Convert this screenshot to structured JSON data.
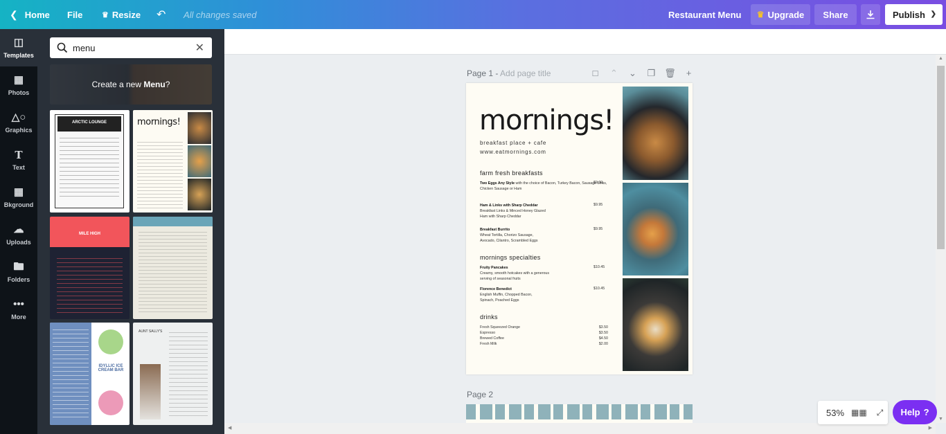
{
  "topbar": {
    "home_label": "Home",
    "file_label": "File",
    "resize_label": "Resize",
    "status": "All changes saved",
    "design_title": "Restaurant Menu",
    "upgrade_label": "Upgrade",
    "share_label": "Share",
    "publish_label": "Publish",
    "icons": {
      "home": "chevron-left-icon",
      "resize": "crown-icon",
      "undo": "undo-icon",
      "download": "download-icon",
      "publish": "chevron-down-icon"
    }
  },
  "rail": {
    "items": [
      {
        "label": "Templates",
        "icon": "templates-icon",
        "active": true
      },
      {
        "label": "Photos",
        "icon": "photos-icon"
      },
      {
        "label": "Graphics",
        "icon": "graphics-icon"
      },
      {
        "label": "Text",
        "icon": "text-icon"
      },
      {
        "label": "Bkground",
        "icon": "background-icon"
      },
      {
        "label": "Uploads",
        "icon": "upload-icon"
      },
      {
        "label": "Folders",
        "icon": "folder-icon"
      },
      {
        "label": "More",
        "icon": "more-icon"
      }
    ]
  },
  "panel": {
    "search_value": "menu",
    "banner_prefix": "Create a new ",
    "banner_bold": "Menu",
    "banner_suffix": "?",
    "templates": {
      "t1": {
        "title": "ARCTIC LOUNGE"
      },
      "t2": {
        "title": "mornings!"
      },
      "t3": {
        "title": "MILE HIGH"
      },
      "t5": {
        "title": "IDYLLIC ICE CREAM BAR"
      },
      "t6": {
        "title": "AUNT SALLY'S"
      }
    }
  },
  "canvas": {
    "page1_label": "Page 1 - ",
    "page1_placeholder": "Add page title",
    "page2_label": "Page 2",
    "page_tools": [
      "notes-icon",
      "chevron-up-icon",
      "chevron-down-icon",
      "duplicate-icon",
      "trash-icon",
      "plus-icon"
    ],
    "menu": {
      "title": "mornings!",
      "subtitle": "breakfast place + cafe",
      "website": "www.eatmornings.com",
      "sections": [
        {
          "name": "farm fresh breakfasts",
          "items": [
            {
              "name": "Two Eggs Any Style",
              "desc": " with the choice of Bacon, Turkey Bacon, Sausage Links, Chicken Sausage or Ham",
              "price": "$9.00"
            },
            {
              "name": "Ham & Links with Sharp Cheddar",
              "desc": "Breakfast Links & Minced Honey Glazed Ham with Sharp Cheddar",
              "price": "$9.95"
            },
            {
              "name": "Breakfast Burrito",
              "desc": "Wheat Tortilla, Chorizo Sausage, Avocado, Cilantro, Scrambled Eggs",
              "price": "$9.95"
            }
          ]
        },
        {
          "name": "mornings specialties",
          "items": [
            {
              "name": "Fruity Pancakes",
              "desc": "Creamy, smooth hotcakes with a generous serving of seasonal fruits",
              "price": "$10.45"
            },
            {
              "name": "Florence Benedict",
              "desc": "English Muffin, Chopped Bacon, Spinach, Poached Eggs",
              "price": "$10.45"
            }
          ]
        },
        {
          "name": "drinks",
          "items": [
            {
              "name": "Fresh Squeezed Orange",
              "price": "$3.50"
            },
            {
              "name": "Espresso",
              "price": "$3.50"
            },
            {
              "name": "Brewed Coffee",
              "price": "$4.50"
            },
            {
              "name": "Fresh Milk",
              "price": "$2.00"
            }
          ]
        }
      ]
    }
  },
  "bottom": {
    "zoom": "53%",
    "help_label": "Help",
    "help_icon": "question-icon"
  },
  "colors": {
    "accent_purple": "#7b2ff2",
    "topbar_start": "#15b3c4",
    "topbar_end": "#7a4de2",
    "panel_bg": "#293039",
    "rail_bg": "#0e1318"
  }
}
